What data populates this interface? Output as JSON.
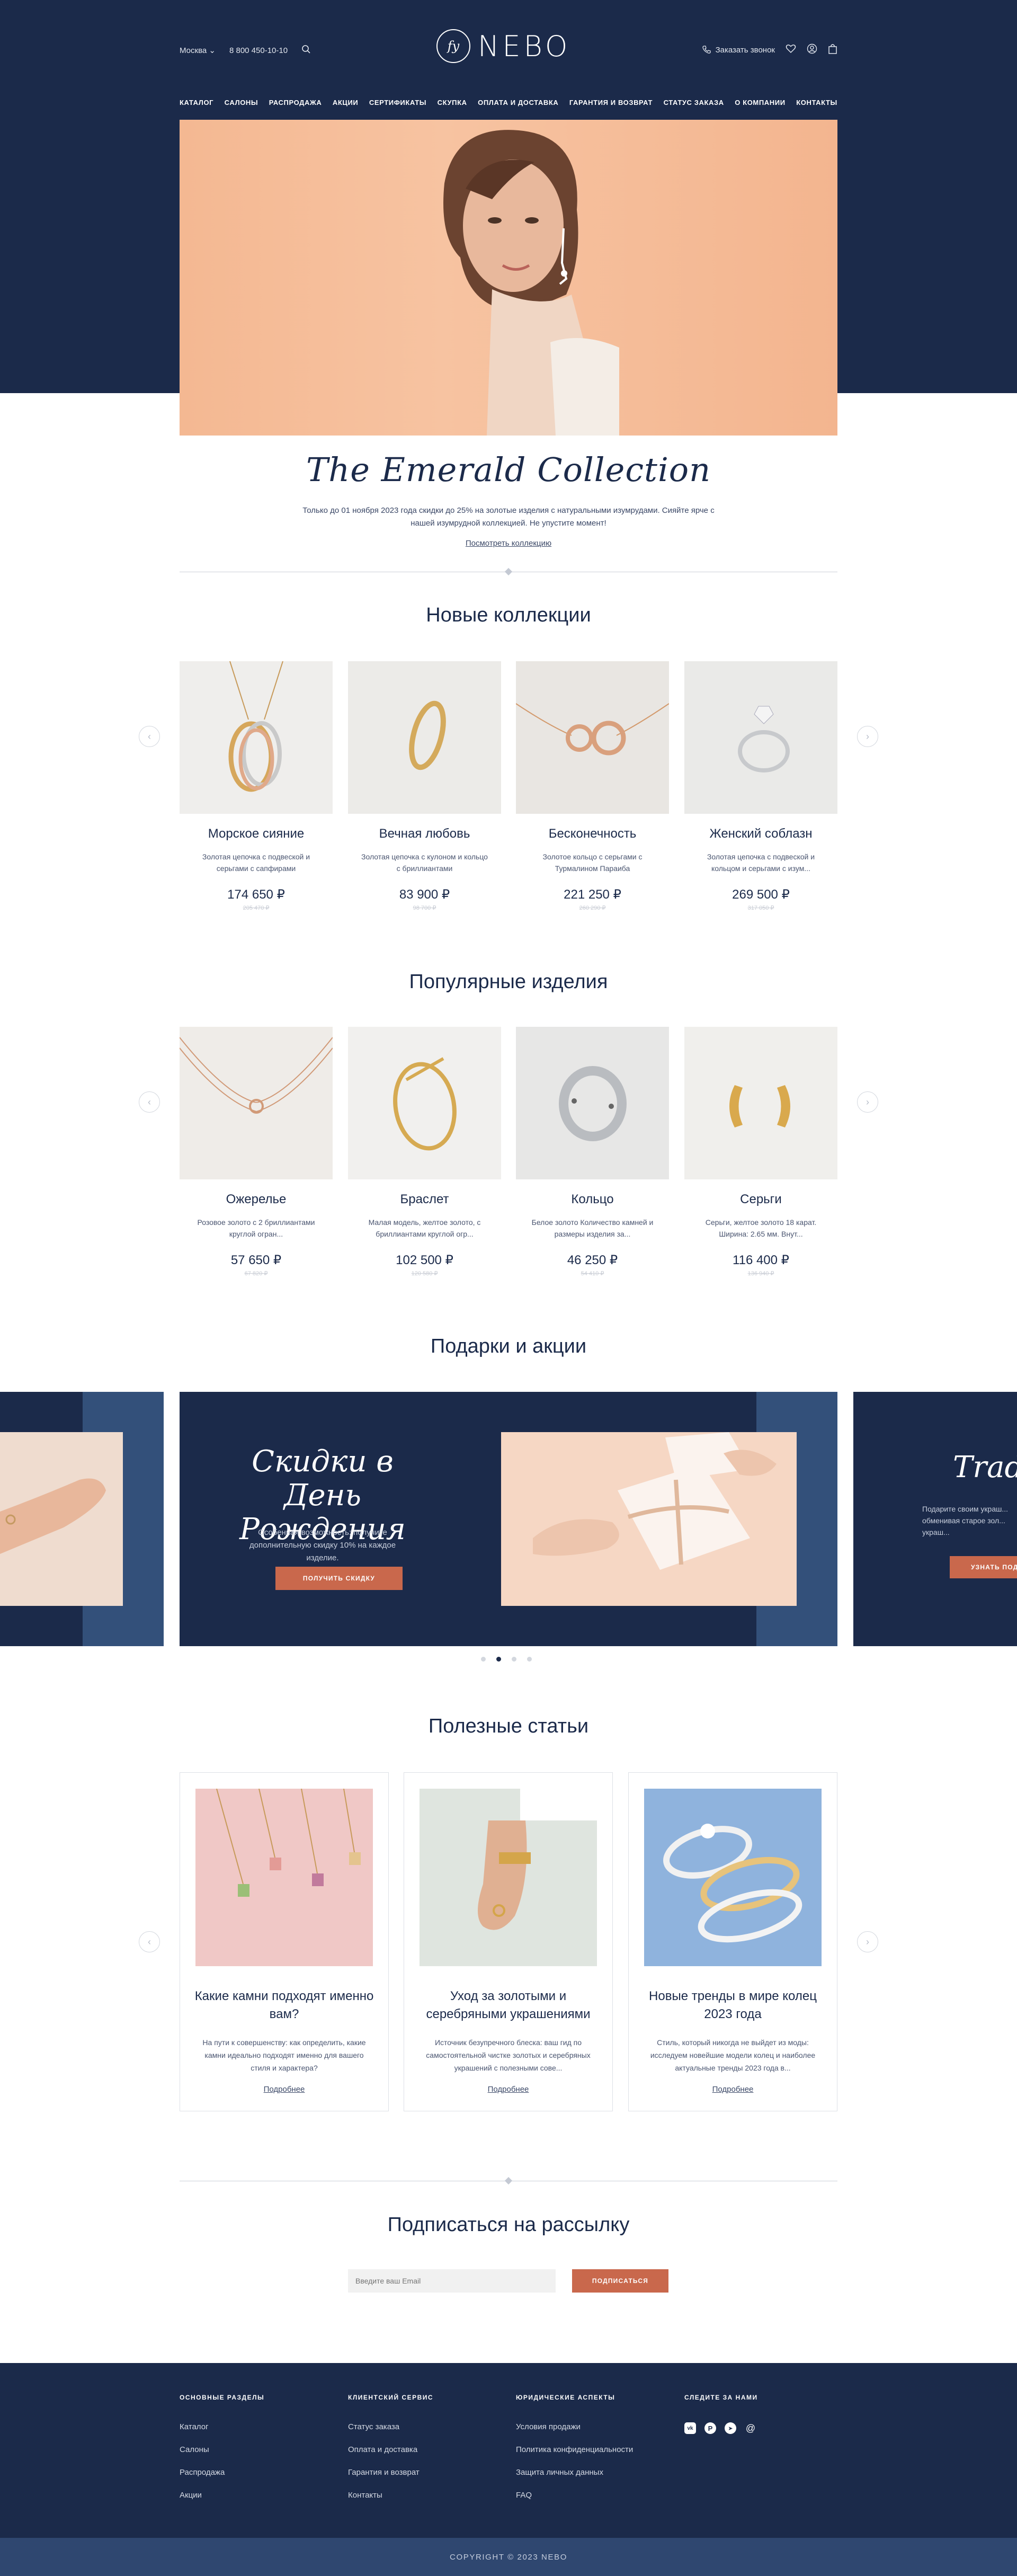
{
  "header": {
    "city": "Москва",
    "phone": "8 800 450-10-10",
    "logo_text": "NEBO",
    "logo_monogram": "fy",
    "callback": "Заказать звонок"
  },
  "nav": [
    "КАТАЛОГ",
    "САЛОНЫ",
    "РАСПРОДАЖА",
    "АКЦИИ",
    "СЕРТИФИКАТЫ",
    "СКУПКА",
    "ОПЛАТА И ДОСТАВКА",
    "ГАРАНТИЯ И ВОЗВРАТ",
    "СТАТУС ЗАКАЗА",
    "О КОМПАНИИ",
    "КОНТАКТЫ"
  ],
  "hero": {
    "title": "The Emerald Collection",
    "desc": "Только до 01 ноября 2023 года скидки до 25% на золотые изделия с натуральными изумрудами. Сияйте ярче с нашей изумрудной коллекцией. Не упустите момент!",
    "link": "Посмотреть коллекцию"
  },
  "new_collections": {
    "title": "Новые коллекции",
    "items": [
      {
        "name": "Морское сияние",
        "desc": "Золотая цепочка с подвеской и серьгами с сапфирами",
        "price": "174 650 ₽",
        "old": "205 470 ₽"
      },
      {
        "name": "Вечная любовь",
        "desc": "Золотая цепочка с кулоном и кольцо с бриллиантами",
        "price": "83 900 ₽",
        "old": "98 700 ₽"
      },
      {
        "name": "Бесконечность",
        "desc": "Золотое кольцо с серьгами с Турмалином Параиба",
        "price": "221 250 ₽",
        "old": "260 290 ₽"
      },
      {
        "name": "Женский соблазн",
        "desc": "Золотая цепочка с подвеской и кольцом и серьгами с изум...",
        "price": "269 500 ₽",
        "old": "317 050 ₽"
      }
    ]
  },
  "popular": {
    "title": "Популярные изделия",
    "items": [
      {
        "name": "Ожерелье",
        "desc": "Розовое золото с 2 бриллиантами круглой огран...",
        "price": "57 650 ₽",
        "old": "67 820 ₽"
      },
      {
        "name": "Браслет",
        "desc": "Малая модель, желтое золото, с бриллиантами круглой огр...",
        "price": "102 500 ₽",
        "old": "120 580 ₽"
      },
      {
        "name": "Кольцо",
        "desc": "Белое золото Количество камней и размеры изделия за...",
        "price": "46 250 ₽",
        "old": "54 410 ₽"
      },
      {
        "name": "Серьги",
        "desc": "Серьги, желтое золото 18 карат. Ширина: 2.65 мм. Внут...",
        "price": "116 400 ₽",
        "old": "136 940 ₽"
      }
    ]
  },
  "gifts": {
    "title": "Подарки и акции",
    "main_title": "Скидки в День Рождения",
    "main_desc": "Особенная возможность: получите дополнительную скидку 10% на каждое изделие.",
    "main_button": "ПОЛУЧИТЬ СКИДКУ",
    "next_title": "Trad",
    "next_desc": "Подарите своим украш... обменивая старое зол... украш...",
    "next_button": "УЗНАТЬ ПОД..."
  },
  "articles": {
    "title": "Полезные статьи",
    "items": [
      {
        "title": "Какие камни подходят именно вам?",
        "desc": "На пути к совершенству: как определить, какие камни идеально подходят именно для вашего стиля и характера?",
        "link": "Подробнее"
      },
      {
        "title": "Уход за золотыми и серебряными украшениями",
        "desc": "Источник безупречного блеска: ваш гид по самостоятельной чистке золотых и серебряных украшений с полезными сове...",
        "link": "Подробнее"
      },
      {
        "title": "Новые тренды в мире колец 2023 года",
        "desc": "Стиль, который никогда не выйдет из моды: исследуем новейшие модели колец и наиболее актуальные тренды 2023 года в...",
        "link": "Подробнее"
      }
    ]
  },
  "subscribe": {
    "title": "Подписаться на рассылку",
    "placeholder": "Введите ваш Email",
    "button": "ПОДПИСАТЬСЯ"
  },
  "footer": {
    "col1": {
      "title": "ОСНОВНЫЕ РАЗДЕЛЫ",
      "links": [
        "Каталог",
        "Салоны",
        "Распродажа",
        "Акции"
      ]
    },
    "col2": {
      "title": "КЛИЕНТСКИЙ СЕРВИС",
      "links": [
        "Статус заказа",
        "Оплата и доставка",
        "Гарантия и возврат",
        "Контакты"
      ]
    },
    "col3": {
      "title": "ЮРИДИЧЕСКИЕ АСПЕКТЫ",
      "links": [
        "Условия продажи",
        "Политика конфиденциальности",
        "Защита личных данных",
        "FAQ"
      ]
    },
    "col4": {
      "title": "СЛЕДИТЕ ЗА НАМИ",
      "icons": [
        "vk-icon",
        "pinterest-icon",
        "telegram-icon",
        "threads-icon"
      ]
    },
    "copyright": "COPYRIGHT © 2023 NEBO"
  },
  "colors": {
    "navy": "#1b2a4a",
    "accent": "#c9684c",
    "slate": "#33507a"
  }
}
